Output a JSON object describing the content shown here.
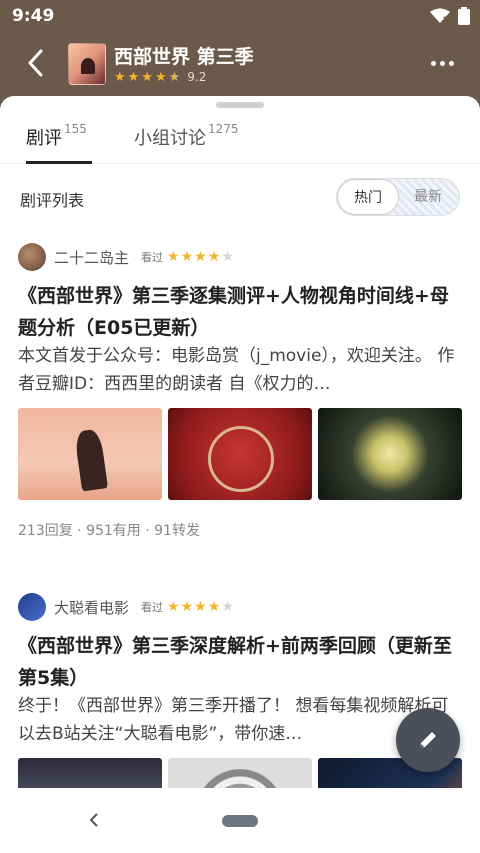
{
  "status": {
    "time": "9:49"
  },
  "header": {
    "title": "西部世界 第三季",
    "rating": "9.2",
    "rating_stars": 4.5
  },
  "tabs": [
    {
      "label": "剧评",
      "count": "155"
    },
    {
      "label": "小组讨论",
      "count": "1275"
    }
  ],
  "list": {
    "label": "剧评列表",
    "sort_hot": "热门",
    "sort_new": "最新"
  },
  "reviews": [
    {
      "author": "二十二岛主",
      "seen_label": "看过",
      "stars": 4,
      "title": "《西部世界》第三季逐集测评+人物视角时间线+母题分析（E05已更新）",
      "summary": "本文首发于公众号：电影岛赏（j_movie），欢迎关注。 作者豆瓣ID：西西里的朗读者 自《权力的…",
      "stats": "213回复 · 951有用 · 91转发"
    },
    {
      "author": "大聪看电影",
      "seen_label": "看过",
      "stars": 4,
      "title": "《西部世界》第三季深度解析+前两季回顾（更新至第5集）",
      "summary": "终于！《西部世界》第三季开播了！ 想看每集视频解析可以去B站关注“大聪看电影”，带你速…"
    }
  ],
  "colors": {
    "header_bg": "#6b5a4a",
    "star": "#f5b32a",
    "fab": "#4a4f5a"
  },
  "icons": [
    "back-arrow-icon",
    "more-icon",
    "edit-pencil-icon",
    "wifi-icon",
    "battery-icon"
  ]
}
